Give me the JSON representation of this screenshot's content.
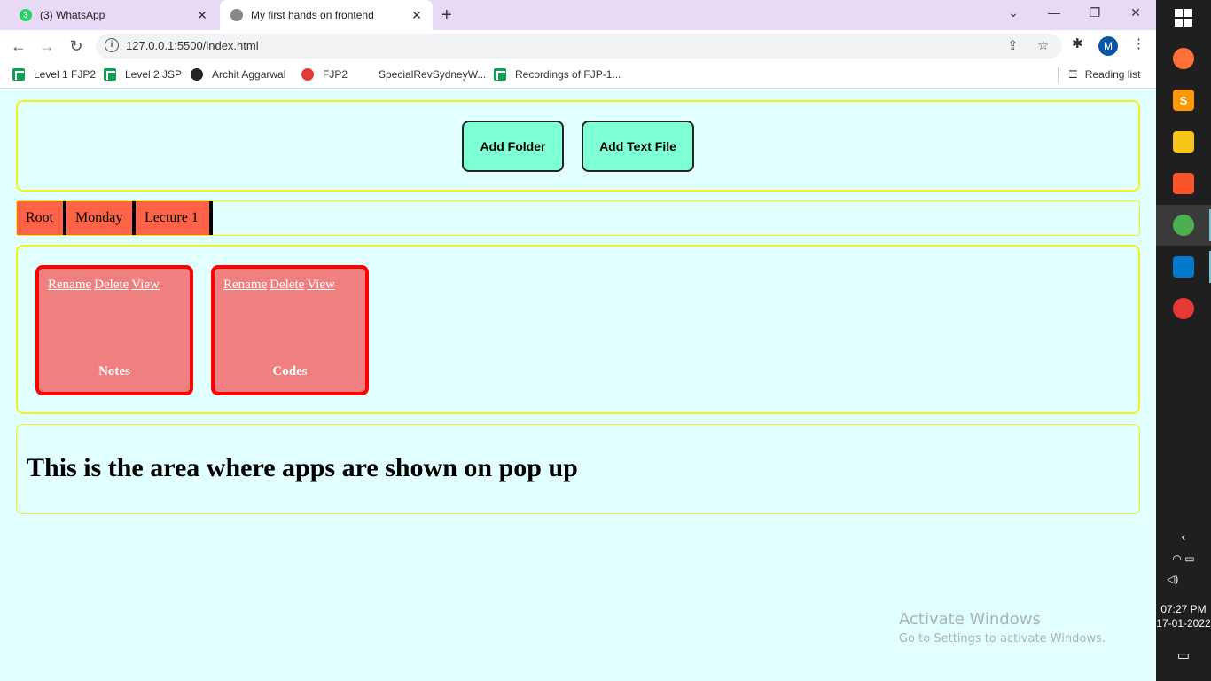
{
  "browser": {
    "tabs": [
      {
        "title": "(3) WhatsApp",
        "badge": "3"
      },
      {
        "title": "My first hands on frontend"
      }
    ],
    "url": "127.0.0.1:5500/index.html",
    "profile_initial": "M",
    "bookmarks": [
      "Level 1 FJP2",
      "Level 2 JSP",
      "Archit Aggarwal",
      "FJP2",
      "SpecialRevSydneyW...",
      "Recordings of FJP-1..."
    ],
    "reading_list": "Reading list"
  },
  "actions": {
    "add_folder": "Add Folder",
    "add_text_file": "Add Text File"
  },
  "breadcrumb": [
    "Root",
    "Monday",
    "Lecture 1"
  ],
  "folders": [
    {
      "rename": "Rename",
      "delete": "Delete",
      "view": "View",
      "name": "Notes"
    },
    {
      "rename": "Rename",
      "delete": "Delete",
      "view": "View",
      "name": "Codes"
    }
  ],
  "app_area": {
    "heading": "This is the area where apps are shown on pop up"
  },
  "watermark": {
    "title": "Activate Windows",
    "subtitle": "Go to Settings to activate Windows."
  },
  "taskbar": {
    "time": "07:27 PM",
    "date": "17-01-2022"
  },
  "colors": {
    "page_bg": "#e0fffe",
    "panel_border": "#f5f21a",
    "button_bg": "#7fffd4",
    "crumb_bg": "#ff6347",
    "card_bg": "#f08080",
    "card_border": "#ff0000"
  }
}
